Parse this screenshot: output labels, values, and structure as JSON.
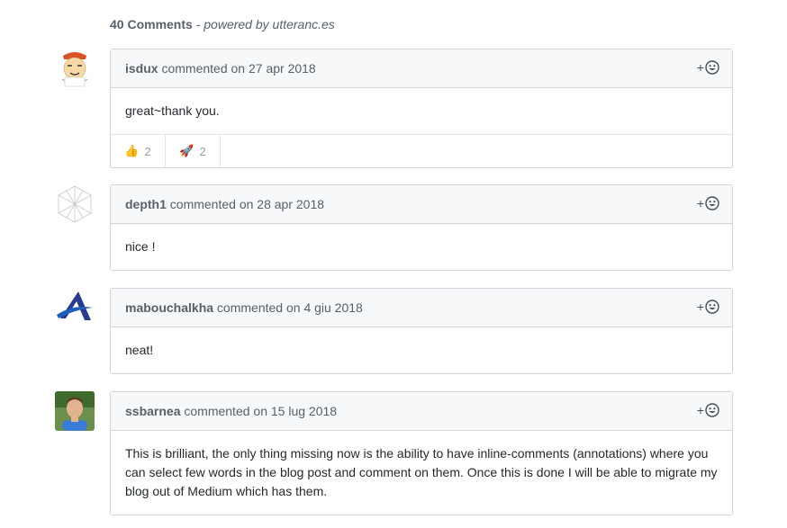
{
  "header": {
    "count": "40 Comments",
    "separator": " - ",
    "powered_prefix": "powered by ",
    "powered_link": "utteranc.es"
  },
  "comments": [
    {
      "author": "isdux",
      "verb": "commented",
      "date_prefix": "on",
      "date": "27 apr 2018",
      "body": "great~thank you.",
      "reactions": [
        {
          "emoji": "👍",
          "count": "2"
        },
        {
          "emoji": "🚀",
          "count": "2"
        }
      ]
    },
    {
      "author": "depth1",
      "verb": "commented",
      "date_prefix": "on",
      "date": "28 apr 2018",
      "body": "nice !"
    },
    {
      "author": "mabouchalkha",
      "verb": "commented",
      "date_prefix": "on",
      "date": "4 giu 2018",
      "body": "neat!"
    },
    {
      "author": "ssbarnea",
      "verb": "commented",
      "date_prefix": "on",
      "date": "15 lug 2018",
      "body": "This is brilliant, the only thing missing now is the ability to have inline-comments (annotations) where you can select few words in the blog post and comment on them. Once this is done I will be able to migrate my blog out of Medium which has them."
    }
  ],
  "reaction_button": {
    "plus": "+",
    "icon": "smiley-icon"
  },
  "colors": {
    "header_bg": "#f6f8fa",
    "border": "#d1d5da",
    "muted": "#586069",
    "text": "#24292e"
  }
}
